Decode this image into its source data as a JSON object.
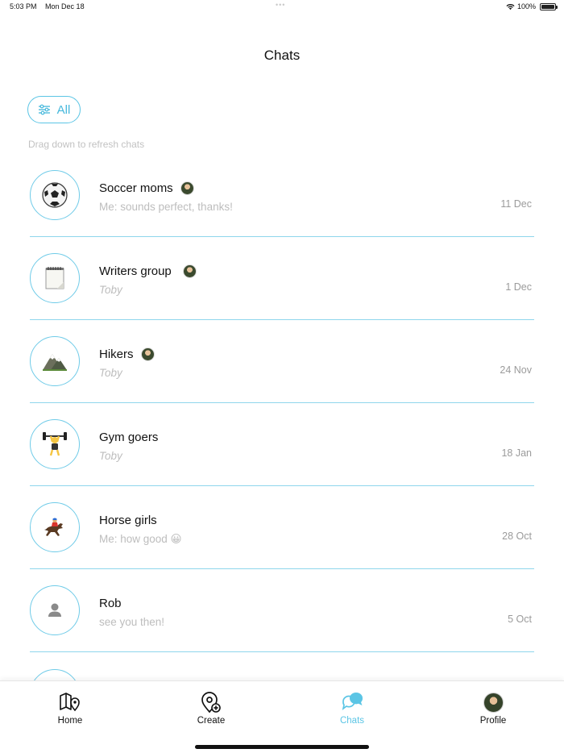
{
  "status_bar": {
    "time": "5:03 PM",
    "date": "Mon Dec 18",
    "battery": "100%",
    "battery_level": 1.0,
    "wifi_icon": "wifi-icon"
  },
  "header": {
    "title": "Chats"
  },
  "filter": {
    "label": "All",
    "icon": "sliders-icon"
  },
  "hint": "Drag down to refresh chats",
  "chats": [
    {
      "name": "Soccer moms",
      "icon": "soccer-ball-icon",
      "preview": "Me: sounds perfect, thanks!",
      "italic": false,
      "date": "11 Dec",
      "has_member_avatar": true
    },
    {
      "name": "Writers group",
      "icon": "notepad-icon",
      "preview": "Toby",
      "italic": true,
      "date": "1 Dec",
      "has_member_avatar": true
    },
    {
      "name": "Hikers",
      "icon": "mountain-icon",
      "preview": "Toby",
      "italic": true,
      "date": "24 Nov",
      "has_member_avatar": true
    },
    {
      "name": "Gym goers",
      "icon": "weightlifter-icon",
      "preview": "Toby",
      "italic": true,
      "date": "18 Jan",
      "has_member_avatar": false
    },
    {
      "name": "Horse girls",
      "icon": "horse-racing-icon",
      "preview": "Me: how good 😀",
      "italic": false,
      "date": "28 Oct",
      "has_member_avatar": false
    },
    {
      "name": "Rob",
      "icon": "person-icon",
      "preview": "see you then!",
      "italic": false,
      "date": "5 Oct",
      "has_member_avatar": false
    }
  ],
  "tabs": [
    {
      "label": "Home",
      "icon": "map-pin-icon",
      "active": false
    },
    {
      "label": "Create",
      "icon": "location-add-icon",
      "active": false
    },
    {
      "label": "Chats",
      "icon": "chat-bubbles-icon",
      "active": true
    },
    {
      "label": "Profile",
      "icon": "profile-avatar",
      "active": false
    }
  ],
  "colors": {
    "accent": "#5bc5e5",
    "divider": "#8fd6ec",
    "muted_text": "#bdbdbd",
    "date_text": "#9b9b9b"
  }
}
